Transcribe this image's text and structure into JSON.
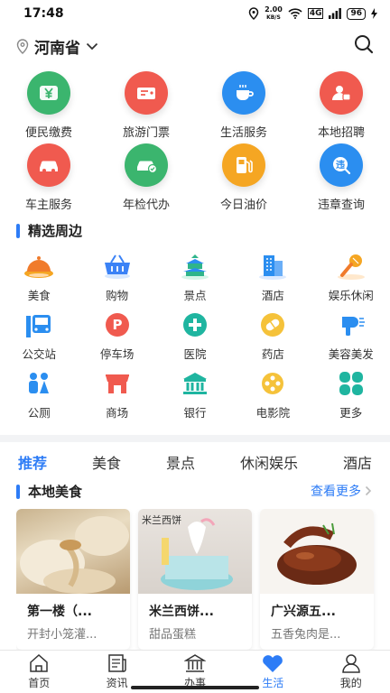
{
  "status": {
    "time": "17:48",
    "net_speed_top": "2.00",
    "net_speed_bottom": "KB/S",
    "network": "4G",
    "battery": "96"
  },
  "header": {
    "region": "河南省",
    "icons": [
      "location-pin-icon",
      "chevron-down-icon",
      "search-icon"
    ]
  },
  "services": [
    {
      "label": "便民缴费",
      "color": "#3bb56e",
      "icon": "yuan-icon"
    },
    {
      "label": "旅游门票",
      "color": "#f05a4f",
      "icon": "ticket-icon"
    },
    {
      "label": "生活服务",
      "color": "#2b8ef0",
      "icon": "cup-icon"
    },
    {
      "label": "本地招聘",
      "color": "#f05a4f",
      "icon": "recruit-icon"
    },
    {
      "label": "车主服务",
      "color": "#f05a4f",
      "icon": "car-icon"
    },
    {
      "label": "年检代办",
      "color": "#3bb56e",
      "icon": "inspection-icon"
    },
    {
      "label": "今日油价",
      "color": "#f5a623",
      "icon": "fuel-icon"
    },
    {
      "label": "违章查询",
      "color": "#2b8ef0",
      "icon": "violation-icon"
    }
  ],
  "nearby": {
    "title": "精选周边",
    "items": [
      {
        "label": "美食",
        "icon": "food-icon"
      },
      {
        "label": "购物",
        "icon": "shopping-basket-icon"
      },
      {
        "label": "景点",
        "icon": "temple-icon"
      },
      {
        "label": "酒店",
        "icon": "hotel-icon"
      },
      {
        "label": "娱乐休闲",
        "icon": "microphone-icon"
      },
      {
        "label": "公交站",
        "icon": "bus-icon"
      },
      {
        "label": "停车场",
        "icon": "parking-icon"
      },
      {
        "label": "医院",
        "icon": "hospital-icon"
      },
      {
        "label": "药店",
        "icon": "pill-icon"
      },
      {
        "label": "美容美发",
        "icon": "hairdryer-icon"
      },
      {
        "label": "公厕",
        "icon": "toilet-icon"
      },
      {
        "label": "商场",
        "icon": "mall-icon"
      },
      {
        "label": "银行",
        "icon": "bank-icon"
      },
      {
        "label": "电影院",
        "icon": "film-icon"
      },
      {
        "label": "更多",
        "icon": "more-icon"
      }
    ]
  },
  "tabs": [
    "推荐",
    "美食",
    "景点",
    "休闲娱乐",
    "酒店"
  ],
  "local_food": {
    "title": "本地美食",
    "more": "查看更多",
    "cards": [
      {
        "title": "第一楼（...",
        "subtitle": "开封小笼灌..."
      },
      {
        "title": "米兰西饼...",
        "subtitle": "甜品蛋糕",
        "image_text": "米兰西饼"
      },
      {
        "title": "广兴源五...",
        "subtitle": "五香兔肉是..."
      }
    ]
  },
  "bottom_nav": [
    {
      "label": "首页",
      "icon": "home-icon"
    },
    {
      "label": "资讯",
      "icon": "news-icon"
    },
    {
      "label": "办事",
      "icon": "government-icon"
    },
    {
      "label": "生活",
      "icon": "heart-icon",
      "active": true
    },
    {
      "label": "我的",
      "icon": "user-icon"
    }
  ],
  "colors": {
    "accent": "#2d7cf6",
    "green": "#3bb56e",
    "red": "#f05a4f",
    "orange": "#f5a623",
    "blue": "#2b8ef0"
  }
}
